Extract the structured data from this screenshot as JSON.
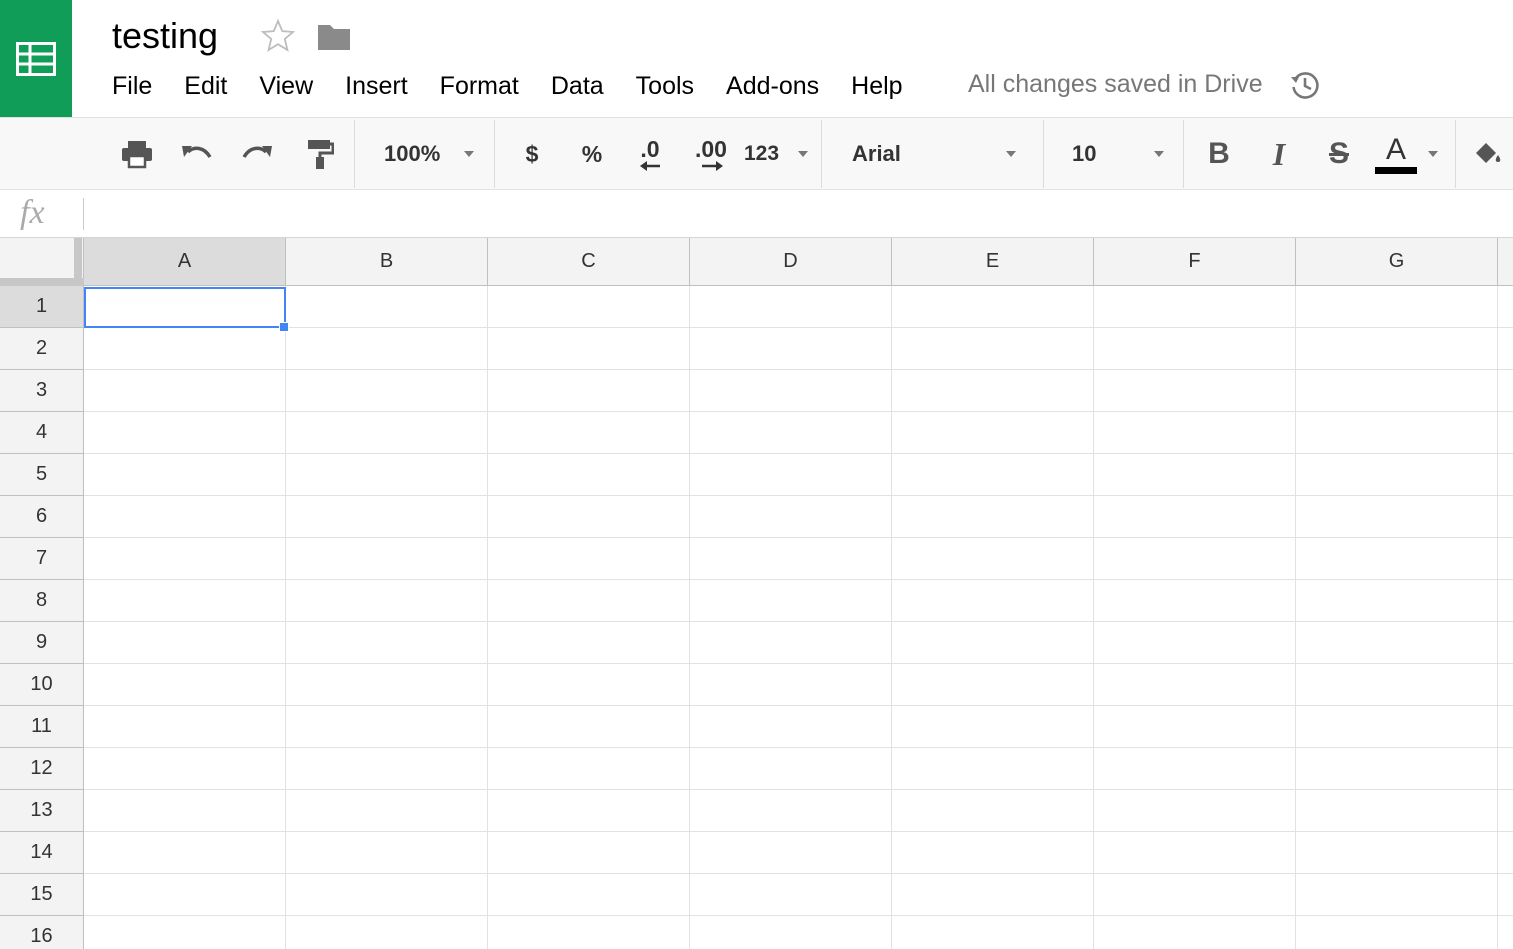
{
  "header": {
    "title": "testing",
    "save_status": "All changes saved in Drive",
    "icons": {
      "logo": "sheets-logo-icon",
      "star": "star-icon",
      "folder": "folder-icon",
      "history": "history-icon"
    },
    "brand_color": "#0f9d58"
  },
  "menu": [
    "File",
    "Edit",
    "View",
    "Insert",
    "Format",
    "Data",
    "Tools",
    "Add-ons",
    "Help"
  ],
  "toolbar": {
    "zoom": "100%",
    "currency_label": "$",
    "percent_label": "%",
    "decrease_decimal_label": ".0",
    "increase_decimal_label": ".00",
    "more_formats_label": "123",
    "font": "Arial",
    "font_size": "10",
    "bold_label": "B",
    "italic_label": "I",
    "strikethrough_label": "S",
    "text_color_label": "A",
    "text_color": "#000000",
    "icons": [
      "print-icon",
      "undo-icon",
      "redo-icon",
      "paint-format-icon",
      "fill-color-icon"
    ]
  },
  "formula_bar": {
    "label": "fx",
    "value": ""
  },
  "grid": {
    "columns": [
      "A",
      "B",
      "C",
      "D",
      "E",
      "F",
      "G"
    ],
    "rows": [
      "1",
      "2",
      "3",
      "4",
      "5",
      "6",
      "7",
      "8",
      "9",
      "10",
      "11",
      "12",
      "13",
      "14",
      "15",
      "16"
    ],
    "selected_cell": "A1",
    "selection_color": "#4285f4"
  }
}
